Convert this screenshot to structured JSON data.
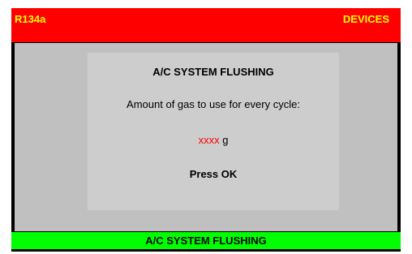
{
  "header": {
    "gas_type": "R134a",
    "section": "DEVICES"
  },
  "dialog": {
    "title": "A/C SYSTEM FLUSHING",
    "prompt": "Amount of gas to use for every cycle:",
    "amount_value": "xxxx",
    "amount_unit": "g",
    "instruction": "Press OK"
  },
  "footer": {
    "label": "A/C SYSTEM FLUSHING"
  },
  "colors": {
    "header_bg": "#ff0000",
    "header_text": "#ffff00",
    "content_bg": "#c0c0c0",
    "footer_bg": "#00ff00",
    "value_text": "#ff0000"
  }
}
